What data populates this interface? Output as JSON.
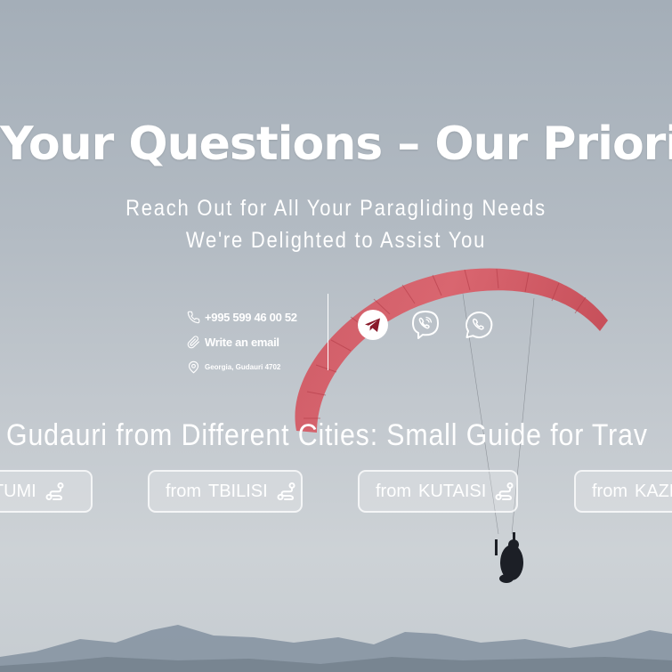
{
  "hero": {
    "title": "Your Questions – Our Priority",
    "subtitle_line1": "Reach Out for All Your Paragliding Needs",
    "subtitle_line2": "We're Delighted to Assist You"
  },
  "contacts": {
    "phone": "+995 599 46 00 52",
    "email_label": "Write an email",
    "address": "Georgia, Gudauri 4702"
  },
  "social": {
    "telegram_icon": "telegram-icon",
    "viber_icon": "viber-icon",
    "whatsapp_icon": "whatsapp-icon",
    "telegram_color": "#8a1a2a"
  },
  "guide": {
    "title": "n Gudauri from Different Cities: Small Guide for Trav",
    "from_label": "from",
    "cities": [
      "ATUMI",
      "TBILISI",
      "KUTAISI",
      "KAZBEG"
    ]
  },
  "colors": {
    "sky_top": "#a4aeb8",
    "sky_bottom": "#c6ccd1",
    "wing": "#d9545e",
    "mountains": "#7e8b99"
  }
}
